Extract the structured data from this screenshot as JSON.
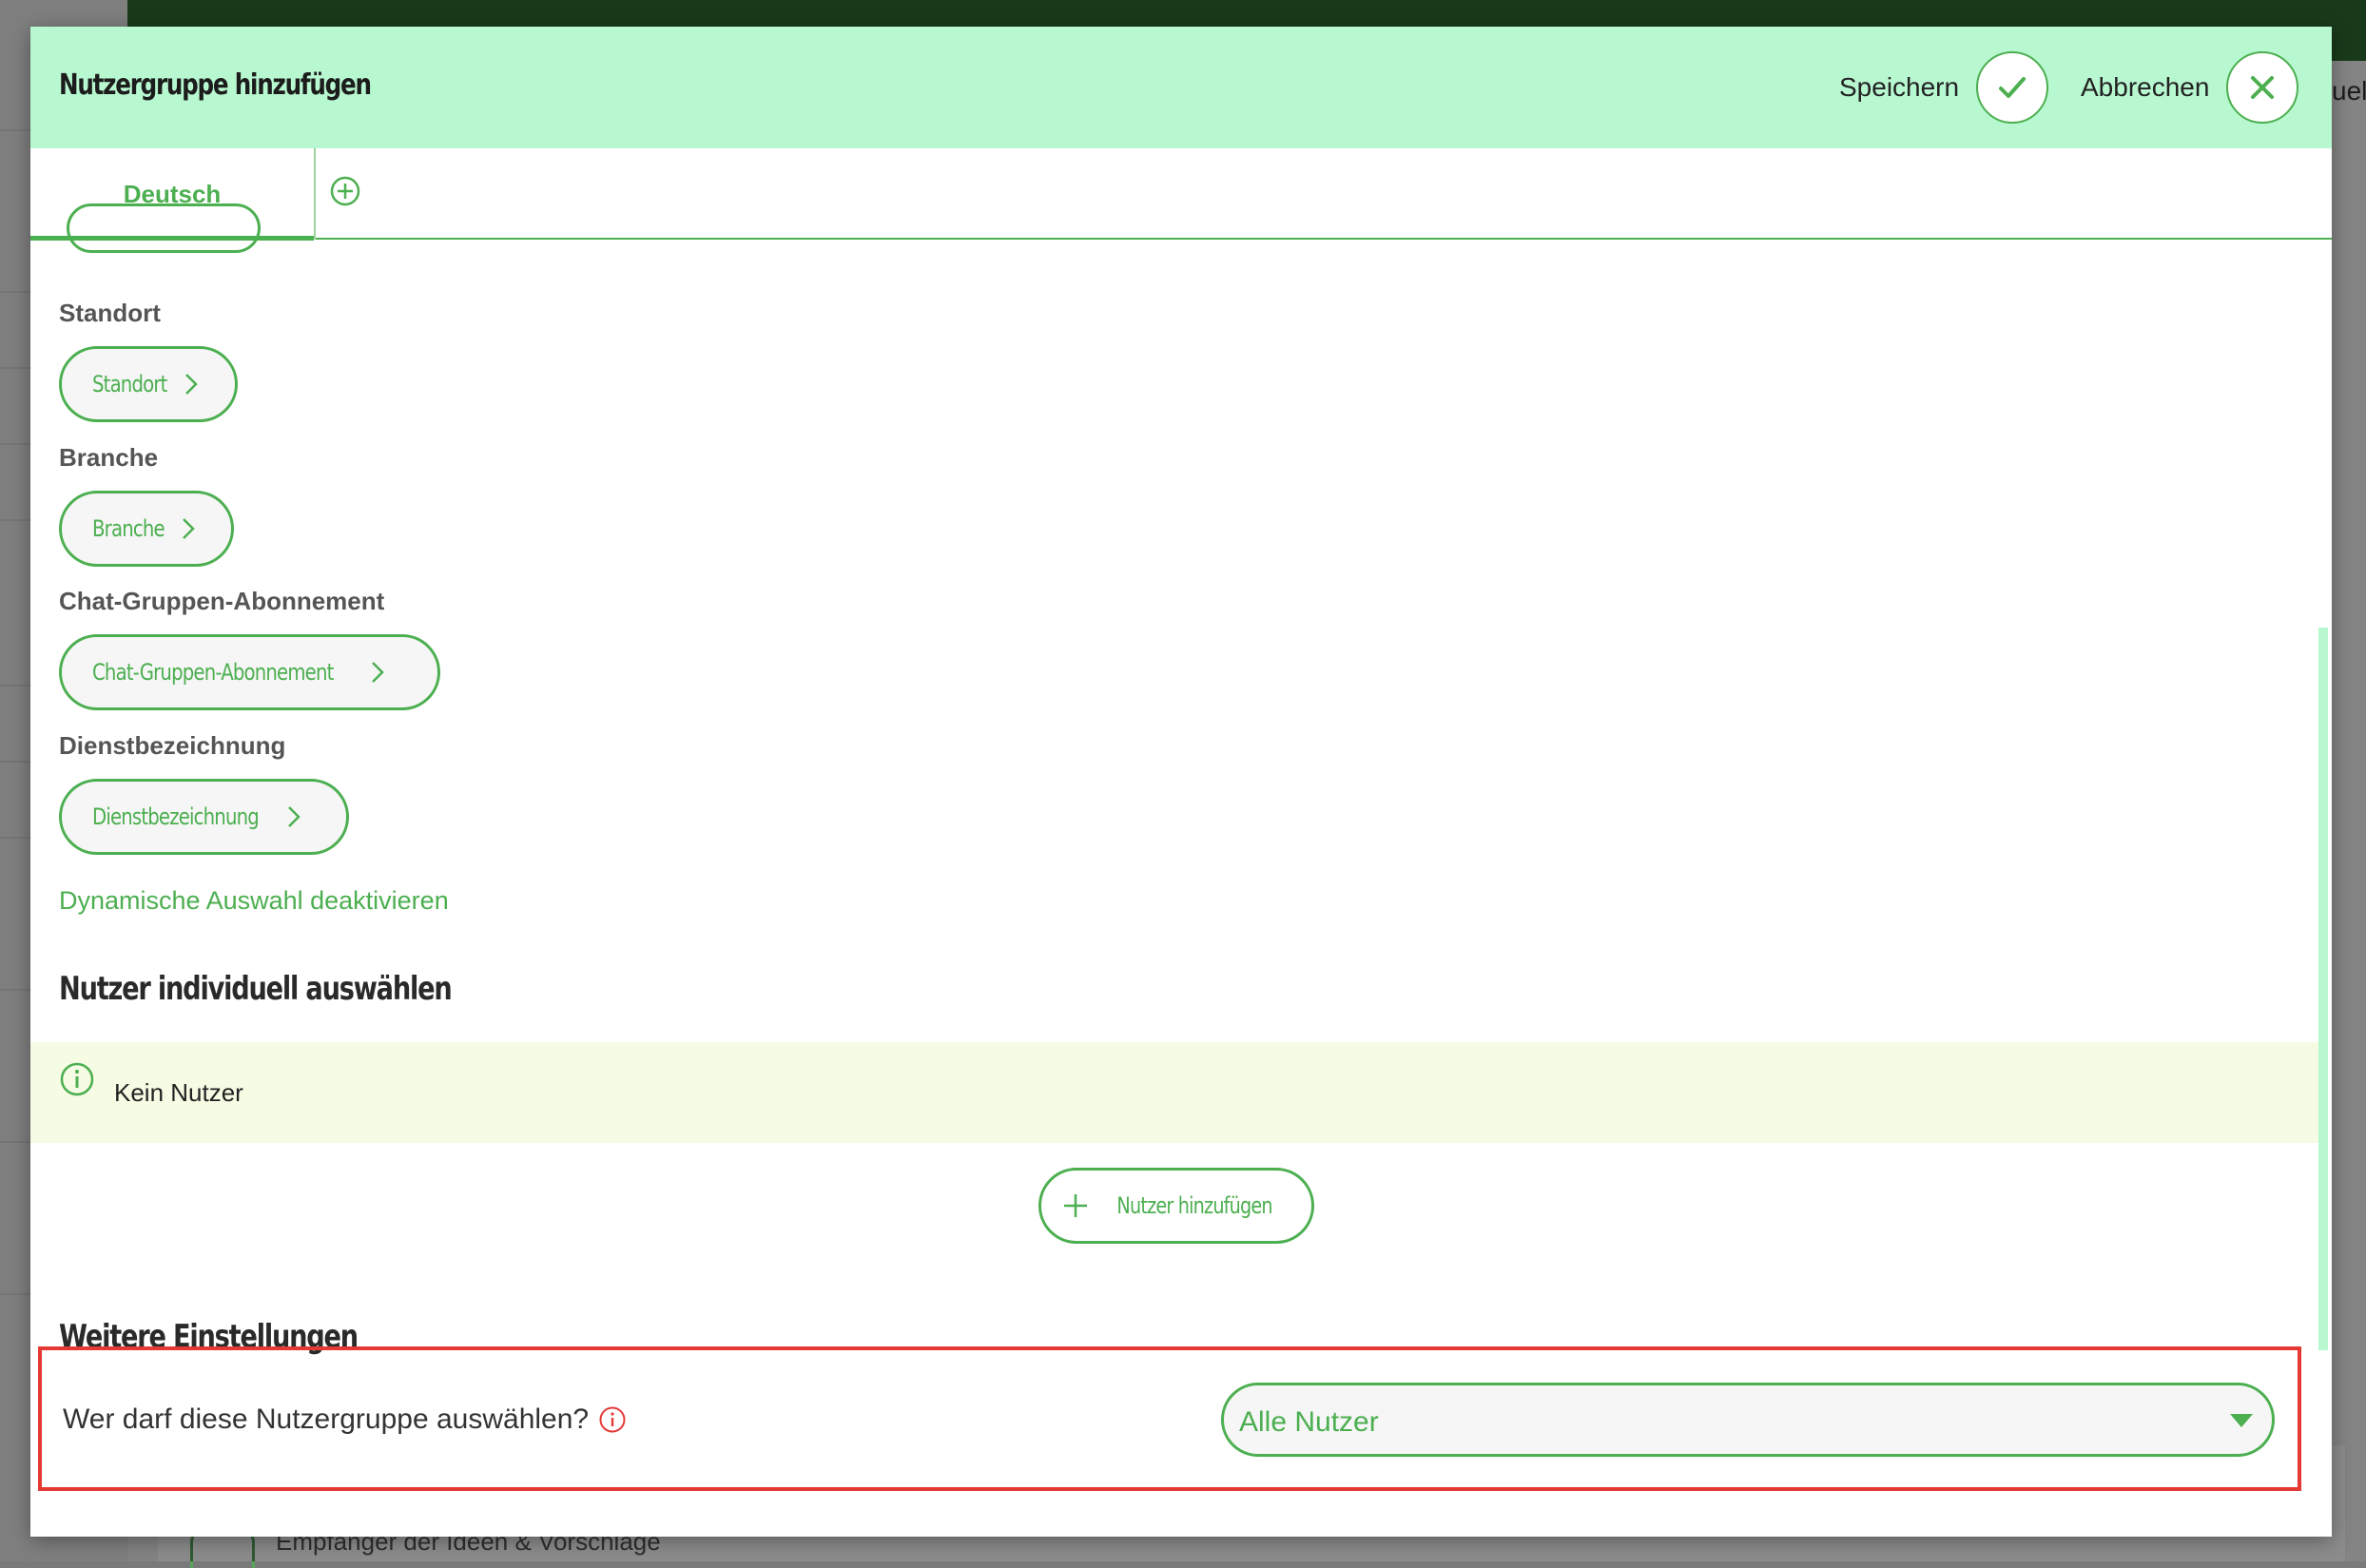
{
  "background": {
    "right_edge_text": "uel",
    "under_item_label": "Empfänger der Ideen & Vorschläge"
  },
  "modal": {
    "title": "Nutzergruppe hinzufügen",
    "save_label": "Speichern",
    "cancel_label": "Abbrechen"
  },
  "tabs": {
    "active_tab": "Deutsch",
    "add_language_icon": "plus-circle-icon"
  },
  "fields": [
    {
      "label": "Standort",
      "button": "Standort"
    },
    {
      "label": "Branche",
      "button": "Branche"
    },
    {
      "label": "Chat-Gruppen-Abonnement",
      "button": "Chat-Gruppen-Abonnement"
    },
    {
      "label": "Dienstbezeichnung",
      "button": "Dienstbezeichnung"
    }
  ],
  "dynamic": {
    "deactivate_link": "Dynamische Auswahl deaktivieren"
  },
  "individual": {
    "title": "Nutzer individuell auswählen",
    "empty_text": "Kein Nutzer",
    "add_button": "Nutzer hinzufügen"
  },
  "settings": {
    "title": "Weitere Einstellungen",
    "question": "Wer darf diese Nutzergruppe auswählen?",
    "select_value": "Alle Nutzer"
  },
  "colors": {
    "accent": "#4caf50",
    "header_bg": "#b8f8d0",
    "topbar": "#2e6b30",
    "info_bg": "#f6fbe3",
    "highlight": "#e53935"
  }
}
